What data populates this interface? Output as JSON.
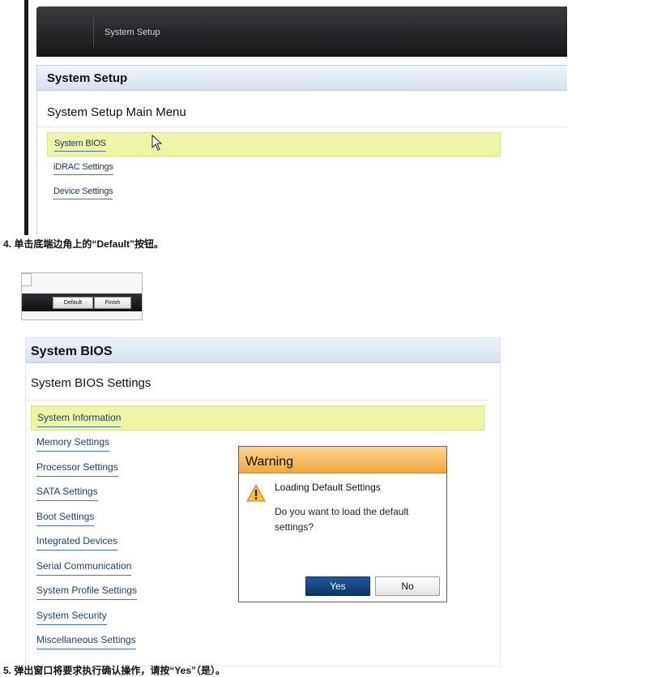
{
  "setup_screenshot": {
    "topbar_title": "System Setup",
    "header": "System Setup",
    "subtitle": "System Setup Main Menu",
    "menu": [
      {
        "label": "System BIOS",
        "selected": true
      },
      {
        "label": "iDRAC Settings"
      },
      {
        "label": "Device Settings"
      }
    ]
  },
  "step4": "4. 单击底端边角上的“Default”按钮。",
  "buttons_screenshot": {
    "default_label": "Default",
    "finish_label": "Finish"
  },
  "bios_screenshot": {
    "header": "System BIOS",
    "subtitle": "System BIOS Settings",
    "menu": [
      {
        "label": "System Information",
        "selected": true
      },
      {
        "label": "Memory Settings"
      },
      {
        "label": "Processor Settings"
      },
      {
        "label": "SATA Settings"
      },
      {
        "label": "Boot Settings"
      },
      {
        "label": "Integrated Devices"
      },
      {
        "label": "Serial Communication"
      },
      {
        "label": "System Profile Settings"
      },
      {
        "label": "System Security"
      },
      {
        "label": "Miscellaneous Settings"
      }
    ],
    "dialog": {
      "title": "Warning",
      "heading": "Loading Default Settings",
      "message": "Do you want to load the default settings?",
      "yes_label": "Yes",
      "no_label": "No",
      "icon": "warning-triangle-icon"
    }
  },
  "step5": "5. 弹出窗口将要求执行确认操作，请按“Yes”（是）。",
  "colors": {
    "highlight": "#eef6a5",
    "link": "#1d3f6b",
    "warning_header": "#f1a83f",
    "yes_button": "#1f5a9c"
  }
}
